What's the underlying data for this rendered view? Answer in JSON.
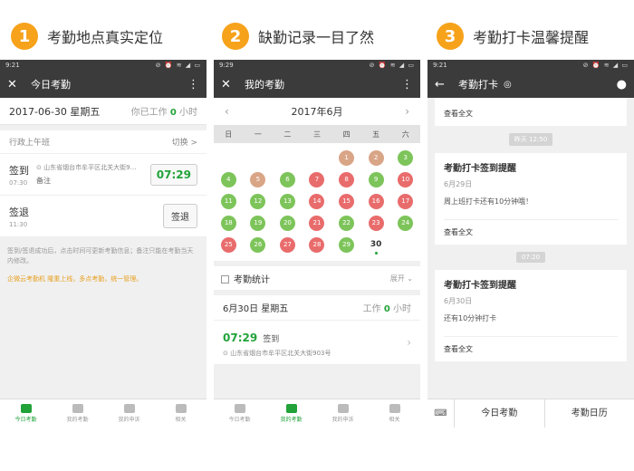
{
  "panels": [
    {
      "num": "1",
      "title": "考勤地点真实定位"
    },
    {
      "num": "2",
      "title": "缺勤记录一目了然"
    },
    {
      "num": "3",
      "title": "考勤打卡温馨提醒"
    }
  ],
  "phone1": {
    "status_time": "9:21",
    "title": "今日考勤",
    "date": "2017-06-30 星期五",
    "worked_prefix": "你已工作",
    "worked_value": "0",
    "worked_unit": "小时",
    "shift_name": "行政上午班",
    "shift_switch": "切换 >",
    "signin_label": "签到",
    "signin_time": "07:30",
    "signin_location": "山东省烟台市牟平区北关大街9…",
    "signin_note": "备注",
    "signin_button": "07:29",
    "signout_label": "签退",
    "signout_time": "11:30",
    "signout_button": "签退",
    "hint": "签到/签退成功后，点击时间可更新考勤信息；备注只能在考勤当天内修改。",
    "ad": "企微云考勤机 隆重上线，多点考勤，统一管理。"
  },
  "tabs": [
    "今日考勤",
    "我的考勤",
    "我的申诉",
    "相关"
  ],
  "phone2": {
    "status_time": "9:29",
    "title": "我的考勤",
    "month": "2017年6月",
    "weekdays": [
      "日",
      "一",
      "二",
      "三",
      "四",
      "五",
      "六"
    ],
    "days": [
      {
        "d": "",
        "c": ""
      },
      {
        "d": "",
        "c": ""
      },
      {
        "d": "",
        "c": ""
      },
      {
        "d": "",
        "c": ""
      },
      {
        "d": "1",
        "c": "#d9a587"
      },
      {
        "d": "2",
        "c": "#d9a587"
      },
      {
        "d": "3",
        "c": "#7dc45a"
      },
      {
        "d": "4",
        "c": "#7dc45a"
      },
      {
        "d": "5",
        "c": "#d9a587"
      },
      {
        "d": "6",
        "c": "#7dc45a"
      },
      {
        "d": "7",
        "c": "#e96c6c"
      },
      {
        "d": "8",
        "c": "#e96c6c"
      },
      {
        "d": "9",
        "c": "#7dc45a"
      },
      {
        "d": "10",
        "c": "#e96c6c"
      },
      {
        "d": "11",
        "c": "#7dc45a"
      },
      {
        "d": "12",
        "c": "#7dc45a"
      },
      {
        "d": "13",
        "c": "#7dc45a"
      },
      {
        "d": "14",
        "c": "#e96c6c"
      },
      {
        "d": "15",
        "c": "#e96c6c"
      },
      {
        "d": "16",
        "c": "#e96c6c"
      },
      {
        "d": "17",
        "c": "#e96c6c"
      },
      {
        "d": "18",
        "c": "#7dc45a"
      },
      {
        "d": "19",
        "c": "#7dc45a"
      },
      {
        "d": "20",
        "c": "#7dc45a"
      },
      {
        "d": "21",
        "c": "#e96c6c"
      },
      {
        "d": "22",
        "c": "#7dc45a"
      },
      {
        "d": "23",
        "c": "#e96c6c"
      },
      {
        "d": "24",
        "c": "#7dc45a"
      },
      {
        "d": "25",
        "c": "#e96c6c"
      },
      {
        "d": "26",
        "c": "#7dc45a"
      },
      {
        "d": "27",
        "c": "#e96c6c"
      },
      {
        "d": "28",
        "c": "#e96c6c"
      },
      {
        "d": "29",
        "c": "#7dc45a"
      },
      {
        "d": "30",
        "c": ""
      }
    ],
    "stats_label": "考勤统计",
    "expand": "展开",
    "day_title": "6月30日 星期五",
    "work_prefix": "工作",
    "work_value": "0",
    "work_unit": "小时",
    "record_time": "07:29",
    "record_type": "签到",
    "record_location": "山东省烟台市牟平区北关大街903号"
  },
  "phone3": {
    "status_time": "9:21",
    "title": "考勤打卡",
    "cards": [
      {
        "title": "",
        "date": "",
        "body": "",
        "more": "查看全文"
      },
      {
        "title": "考勤打卡签到提醒",
        "date": "6月29日",
        "body": "周上班打卡还有10分钟哦！",
        "more": "查看全文"
      },
      {
        "title": "考勤打卡签到提醒",
        "date": "6月30日",
        "body": "还有10分钟打卡",
        "more": "查看全文"
      }
    ],
    "timestamps": [
      "昨天 12:50",
      "07:20"
    ],
    "bottom_buttons": [
      "今日考勤",
      "考勤日历"
    ]
  }
}
